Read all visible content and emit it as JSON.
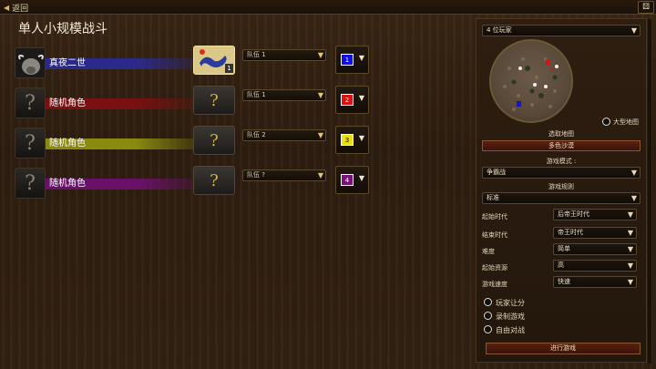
{
  "topbar": {
    "back_label": "返回",
    "corner_icon": "gamepad-icon"
  },
  "page_title": "单人小规模战斗",
  "players": [
    {
      "name": "真夜二世",
      "bar_color": "#2b2a8a",
      "civ_type": "flag",
      "civ_num": "1",
      "team": "队伍 1",
      "player_color": "#1010e0",
      "color_num": "1",
      "portrait": "buffalo"
    },
    {
      "name": "随机角色",
      "bar_color": "#7a1010",
      "civ_type": "random",
      "civ_glyph": "?",
      "team": "队伍 1",
      "player_color": "#e01010",
      "color_num": "2",
      "portrait": "?"
    },
    {
      "name": "随机角色",
      "bar_color": "#8a8a10",
      "civ_type": "random",
      "civ_glyph": "?",
      "team": "队伍 2",
      "player_color": "#e8e010",
      "color_num": "3",
      "portrait": "?"
    },
    {
      "name": "随机角色",
      "bar_color": "#6a106a",
      "civ_type": "random",
      "civ_glyph": "?",
      "team": "队伍 ?",
      "player_color": "#7a107a",
      "color_num": "4",
      "portrait": "?"
    }
  ],
  "settings": {
    "player_count": "4 位玩家",
    "large_map_label": "大型地图",
    "select_map_label": "选取地图",
    "map_name": "多色沙漠",
    "game_mode_label": "游戏模式 :",
    "game_mode": "争霸战",
    "rules_label": "游戏规则",
    "rules": "标准",
    "rows": [
      {
        "label": "起始时代",
        "value": "后帝王时代"
      },
      {
        "label": "结束时代",
        "value": "帝王时代"
      },
      {
        "label": "难度",
        "value": "简单"
      },
      {
        "label": "起始资源",
        "value": "高"
      },
      {
        "label": "游戏速度",
        "value": "快速"
      }
    ],
    "options": [
      "玩家让分",
      "录制游戏",
      "自由对战"
    ],
    "start_button": "进行游戏"
  }
}
